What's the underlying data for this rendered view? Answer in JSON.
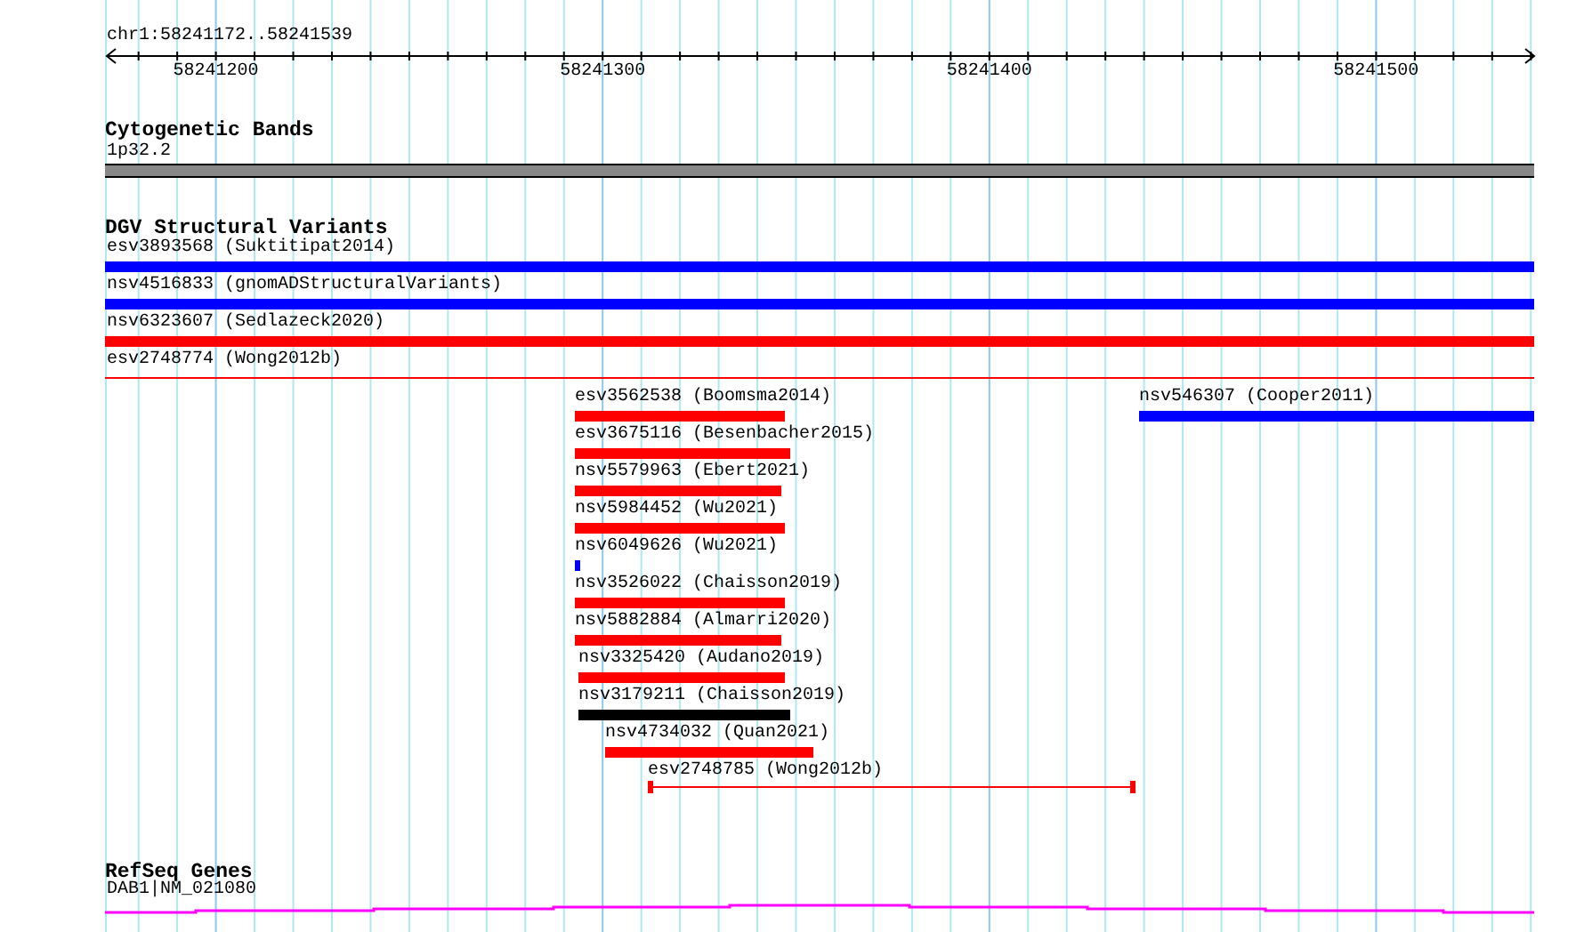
{
  "ruler": {
    "location": "chr1:58241172..58241539",
    "ticks": [
      "58241200",
      "58241300",
      "58241400",
      "58241500"
    ]
  },
  "tracks": [
    {
      "title": "Cytogenetic Bands",
      "features": [
        {
          "label": "1p32.2",
          "kind": "band"
        }
      ]
    },
    {
      "title": "DGV Structural Variants",
      "features": [
        {
          "label": "esv3893568 (Suktitipat2014)",
          "kind": "bar",
          "color": "#0000ff"
        },
        {
          "label": "nsv4516833 (gnomADStructuralVariants)",
          "kind": "bar",
          "color": "#0000ff"
        },
        {
          "label": "nsv6323607 (Sedlazeck2020)",
          "kind": "bar",
          "color": "#ff0000"
        },
        {
          "label": "esv2748774 (Wong2012b)",
          "kind": "line",
          "color": "#ff0000"
        },
        {
          "label": "esv3562538 (Boomsma2014)",
          "kind": "bar",
          "color": "#ff0000"
        },
        {
          "label": "nsv546307 (Cooper2011)",
          "kind": "bar",
          "color": "#0000ff"
        },
        {
          "label": "esv3675116 (Besenbacher2015)",
          "kind": "bar",
          "color": "#ff0000"
        },
        {
          "label": "nsv5579963 (Ebert2021)",
          "kind": "bar",
          "color": "#ff0000"
        },
        {
          "label": "nsv5984452 (Wu2021)",
          "kind": "bar",
          "color": "#ff0000"
        },
        {
          "label": "nsv6049626 (Wu2021)",
          "kind": "bar",
          "color": "#0000ff"
        },
        {
          "label": "nsv3526022 (Chaisson2019)",
          "kind": "bar",
          "color": "#ff0000"
        },
        {
          "label": "nsv5882884 (Almarri2020)",
          "kind": "bar",
          "color": "#ff0000"
        },
        {
          "label": "nsv3325420 (Audano2019)",
          "kind": "bar",
          "color": "#ff0000"
        },
        {
          "label": "nsv3179211 (Chaisson2019)",
          "kind": "bar",
          "color": "#000000"
        },
        {
          "label": "nsv4734032 (Quan2021)",
          "kind": "bar",
          "color": "#ff0000"
        },
        {
          "label": "esv2748785 (Wong2012b)",
          "kind": "gapped",
          "color": "#ff0000"
        }
      ]
    },
    {
      "title": "RefSeq Genes",
      "features": [
        {
          "label": "DAB1|NM_021080",
          "kind": "transcript",
          "color": "#ff00ff"
        }
      ]
    }
  ]
}
